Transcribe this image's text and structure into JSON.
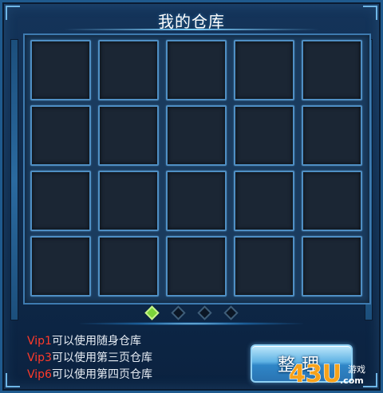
{
  "window": {
    "title": "我的仓库"
  },
  "storage": {
    "rows": 4,
    "cols": 5,
    "slots": [
      {},
      {},
      {},
      {},
      {},
      {},
      {},
      {},
      {},
      {},
      {},
      {},
      {},
      {},
      {},
      {},
      {},
      {},
      {},
      {}
    ]
  },
  "pager": {
    "pages": 4,
    "current": 1
  },
  "info": {
    "lines": [
      {
        "vip": "Vip1",
        "text": "可以使用随身仓库"
      },
      {
        "vip": "Vip3",
        "text": "可以使用第三页仓库"
      },
      {
        "vip": "Vip6",
        "text": "可以使用第四页仓库"
      }
    ]
  },
  "buttons": {
    "sort_label": "整理"
  },
  "watermark": {
    "brand": "43u.com",
    "suffix": "游戏"
  },
  "colors": {
    "vip_text": "#ff3a2a",
    "active_page": "#7bd43a",
    "slot_border": "#4f8fc4"
  }
}
